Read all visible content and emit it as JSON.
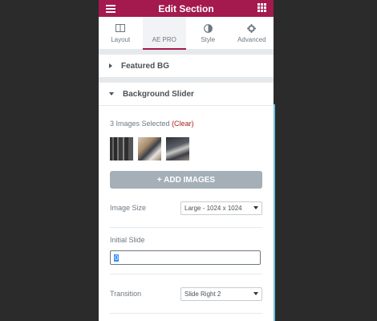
{
  "header": {
    "title": "Edit Section"
  },
  "tabs": [
    {
      "label": "Layout",
      "icon": "layout-icon"
    },
    {
      "label": "AE PRO",
      "icon": "none"
    },
    {
      "label": "Style",
      "icon": "half-circle-icon"
    },
    {
      "label": "Advanced",
      "icon": "gear-icon"
    }
  ],
  "sections": {
    "featured_bg": {
      "label": "Featured BG"
    },
    "background_slider": {
      "label": "Background Slider"
    }
  },
  "slider": {
    "selected_text": "3 Images Selected",
    "clear_label": "(Clear)",
    "add_images_label": "+ ADD IMAGES",
    "image_size_label": "Image Size",
    "image_size_value": "Large - 1024 x 1024",
    "initial_slide_label": "Initial Slide",
    "initial_slide_value": "0",
    "transition_label": "Transition",
    "transition_value": "Slide Right 2"
  },
  "colors": {
    "brand": "#a4194e",
    "accent": "#6ec1e4",
    "button": "#a4afb7",
    "clear": "#b01b1b"
  }
}
